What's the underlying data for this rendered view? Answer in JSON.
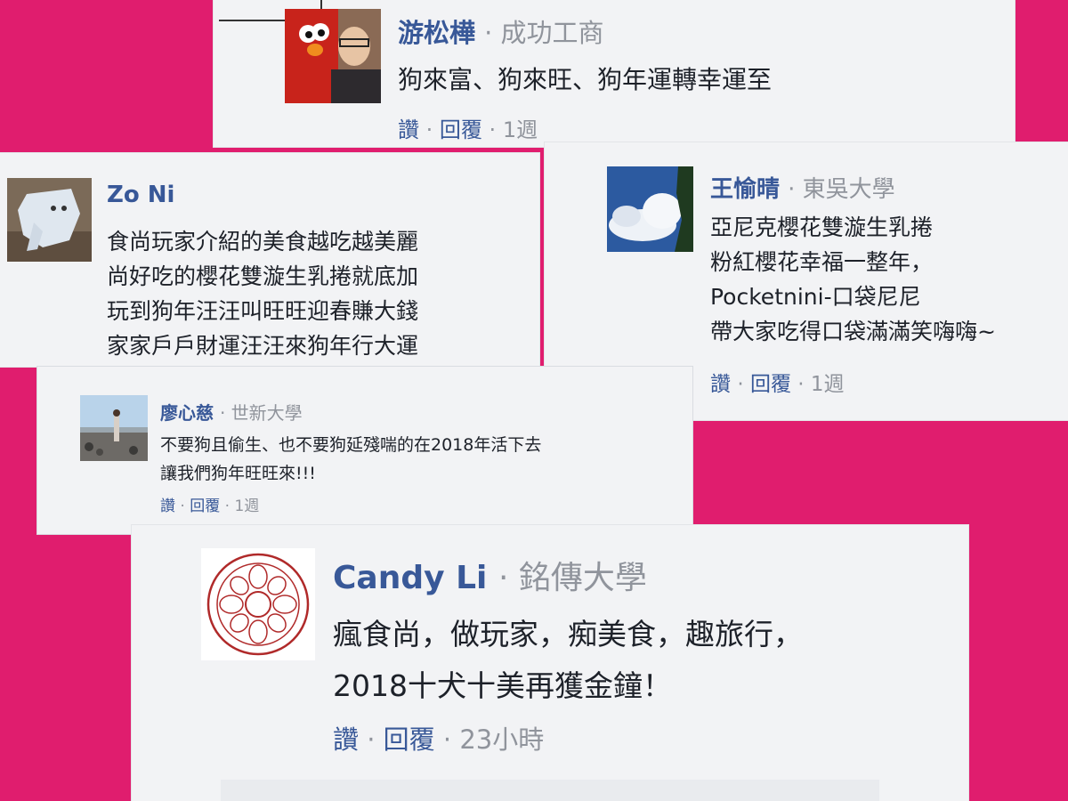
{
  "comments": [
    {
      "name": "游松樺",
      "meta": "· 成功工商",
      "lines": [
        "狗來富、狗來旺、狗年運轉幸運至"
      ],
      "like": "讚",
      "reply": "回覆",
      "time": "1週",
      "avatar_icon": "elmo-photo-avatar-icon"
    },
    {
      "name": "Zo Ni",
      "meta": "",
      "lines": [
        "食尚玩家介紹的美食越吃越美麗",
        "尚好吃的櫻花雙漩生乳捲就底加",
        "玩到狗年汪汪叫旺旺迎春賺大錢",
        "家家戶戶財運汪汪來狗年行大運"
      ],
      "avatar_icon": "paper-elephant-avatar-icon"
    },
    {
      "name": "王愉晴",
      "meta": "· 東吳大學",
      "lines": [
        "亞尼克櫻花雙漩生乳捲",
        "粉紅櫻花幸福一整年，",
        "Pocketnini-口袋尼尼",
        "帶大家吃得口袋滿滿笑嗨嗨~"
      ],
      "like": "讚",
      "reply": "回覆",
      "time": "1週",
      "avatar_icon": "sky-clouds-avatar-icon"
    },
    {
      "name": "廖心慈",
      "meta": "· 世新大學",
      "lines": [
        "不要狗且偷生、也不要狗延殘喘的在2018年活下去",
        "讓我們狗年旺旺來!!!"
      ],
      "like": "讚",
      "reply": "回覆",
      "time": "1週",
      "avatar_icon": "beach-person-avatar-icon"
    },
    {
      "name": "Candy Li",
      "meta": "· 銘傳大學",
      "lines": [
        "瘋食尚，做玩家，痴美食，趣旅行，",
        "2018十犬十美再獲金鐘！"
      ],
      "like": "讚",
      "reply": "回覆",
      "time": "23小時",
      "avatar_icon": "red-seal-logo-avatar-icon"
    }
  ],
  "colors": {
    "background": "#e01d6e",
    "card": "#f2f3f5",
    "name_link": "#385898",
    "meta_text": "#90949c",
    "body_text": "#1d2129"
  }
}
